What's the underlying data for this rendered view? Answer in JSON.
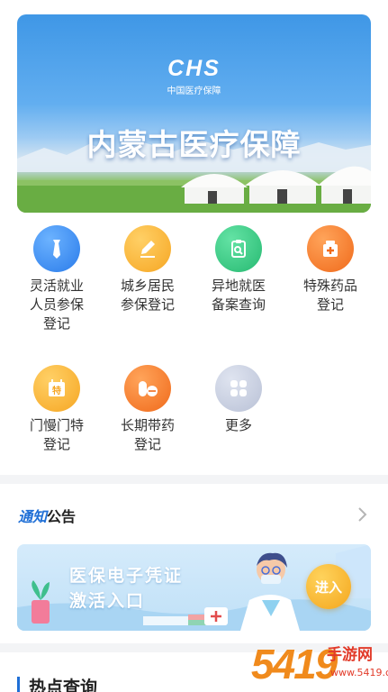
{
  "banner": {
    "logo": "CHS",
    "logo_sub": "中国医疗保障",
    "title": "内蒙古医疗保障"
  },
  "services": [
    {
      "label": "灵活就业\n人员参保\n登记",
      "icon": "tie-icon",
      "color": "#2a7bea"
    },
    {
      "label": "城乡居民\n参保登记",
      "icon": "pen-edit-icon",
      "color": "#f6a623"
    },
    {
      "label": "异地就医\n备案查询",
      "icon": "clipboard-search-icon",
      "color": "#26b971"
    },
    {
      "label": "特殊药品\n登记",
      "icon": "medicine-box-icon",
      "color": "#f06a1b"
    },
    {
      "label": "门慢门特\n登记",
      "icon": "calendar-special-icon",
      "color": "#f6a623"
    },
    {
      "label": "长期带药\n登记",
      "icon": "pills-icon",
      "color": "#f06a1b"
    },
    {
      "label": "更多",
      "icon": "grid-more-icon",
      "color": "#b9c1d6"
    }
  ],
  "notice": {
    "title_accent": "通知",
    "title_rest": "公告"
  },
  "promo": {
    "line1": "医保电子凭证",
    "line2": "激活入口",
    "button": "进入"
  },
  "hot": {
    "title": "热点查询"
  },
  "watermark": {
    "number": "5419",
    "name": "手游网",
    "url": "www.5419.cn"
  },
  "colors": {
    "accent": "#1f6fd6",
    "background": "#f3f4f6"
  }
}
